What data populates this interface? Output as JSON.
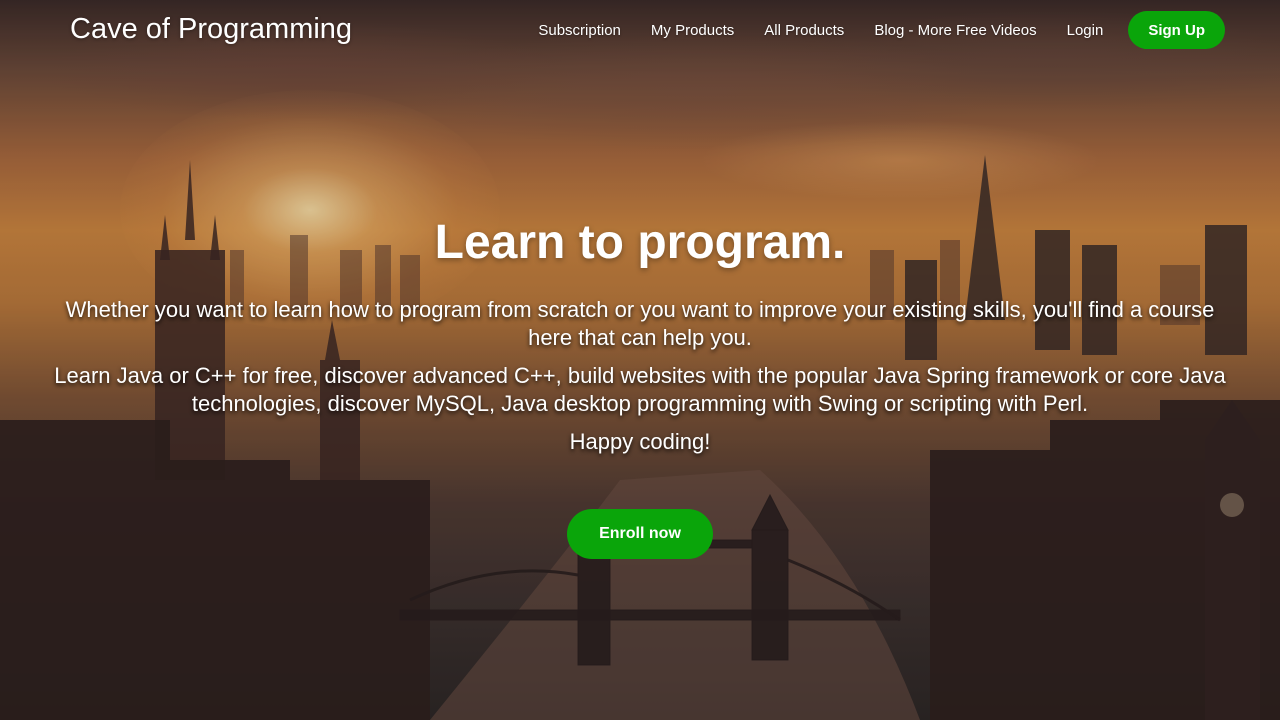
{
  "header": {
    "logo": "Cave of Programming",
    "nav": [
      {
        "label": "Subscription"
      },
      {
        "label": "My Products"
      },
      {
        "label": "All Products"
      },
      {
        "label": "Blog - More Free Videos"
      },
      {
        "label": "Login"
      }
    ],
    "signup_label": "Sign Up"
  },
  "hero": {
    "title": "Learn to program.",
    "paragraphs": [
      "Whether you want to learn how to program from scratch or you want to improve your existing skills, you'll find a course here that can help you.",
      "Learn Java or C++ for free, discover advanced C++, build websites with the popular Java Spring framework or core Java technologies, discover MySQL, Java desktop programming with Swing or scripting with Perl.",
      "Happy coding!"
    ],
    "cta_label": "Enroll now"
  },
  "colors": {
    "accent": "#0aa50a",
    "text": "#ffffff"
  }
}
